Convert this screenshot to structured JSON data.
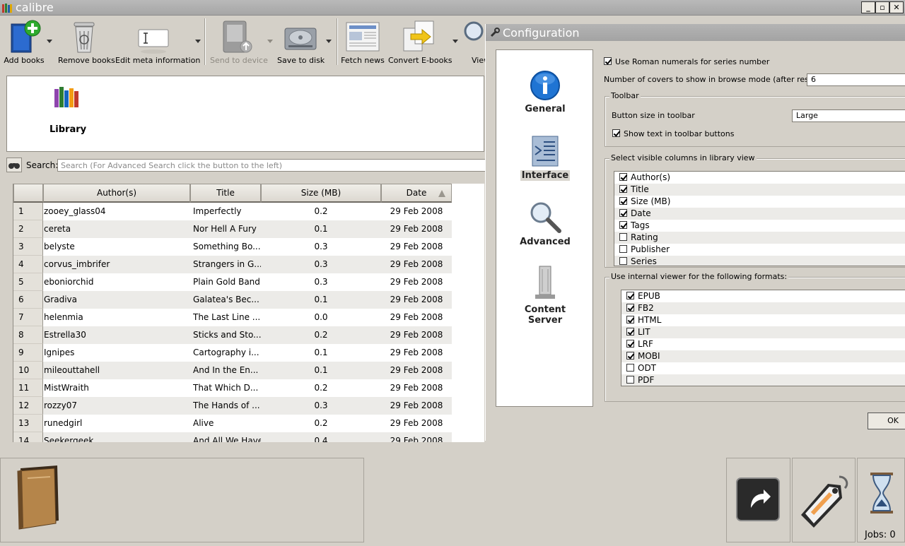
{
  "window": {
    "title": "calibre"
  },
  "toolbar": {
    "buttons": [
      {
        "label": "Add books",
        "icon": "add-book-icon",
        "disabled": false
      },
      {
        "label": "Remove books",
        "icon": "trash-icon",
        "disabled": false
      },
      {
        "label": "Edit meta information",
        "icon": "edit-metadata-icon",
        "disabled": false
      },
      {
        "label": "Send to device",
        "icon": "send-device-icon",
        "disabled": true
      },
      {
        "label": "Save to disk",
        "icon": "save-disk-icon",
        "disabled": false
      },
      {
        "label": "Fetch news",
        "icon": "news-icon",
        "disabled": false
      },
      {
        "label": "Convert E-books",
        "icon": "convert-icon",
        "disabled": false
      },
      {
        "label": "View",
        "icon": "view-icon",
        "disabled": false
      }
    ]
  },
  "location": {
    "library_label": "Library"
  },
  "search": {
    "label": "Search:",
    "placeholder": "Search (For Advanced Search click the button to the left)"
  },
  "table": {
    "headers": {
      "author": "Author(s)",
      "title": "Title",
      "size": "Size (MB)",
      "date": "Date"
    },
    "rows": [
      {
        "num": "1",
        "author": "zooey_glass04",
        "title": "Imperfectly",
        "size": "0.2",
        "date": "29 Feb 2008"
      },
      {
        "num": "2",
        "author": "cereta",
        "title": "Nor Hell A Fury",
        "size": "0.1",
        "date": "29 Feb 2008"
      },
      {
        "num": "3",
        "author": "belyste",
        "title": "Something Bo...",
        "size": "0.3",
        "date": "29 Feb 2008"
      },
      {
        "num": "4",
        "author": "corvus_imbrifer",
        "title": "Strangers in G...",
        "size": "0.3",
        "date": "29 Feb 2008"
      },
      {
        "num": "5",
        "author": "eboniorchid",
        "title": "Plain Gold Band",
        "size": "0.3",
        "date": "29 Feb 2008"
      },
      {
        "num": "6",
        "author": "Gradiva",
        "title": "Galatea's Bec...",
        "size": "0.1",
        "date": "29 Feb 2008"
      },
      {
        "num": "7",
        "author": "helenmia",
        "title": "The Last Line ...",
        "size": "0.0",
        "date": "29 Feb 2008"
      },
      {
        "num": "8",
        "author": "Estrella30",
        "title": "Sticks and Sto...",
        "size": "0.2",
        "date": "29 Feb 2008"
      },
      {
        "num": "9",
        "author": "Ignipes",
        "title": "Cartography i...",
        "size": "0.1",
        "date": "29 Feb 2008"
      },
      {
        "num": "10",
        "author": "mileouttahell",
        "title": "And In the En...",
        "size": "0.1",
        "date": "29 Feb 2008"
      },
      {
        "num": "11",
        "author": "MistWraith",
        "title": "That Which D...",
        "size": "0.2",
        "date": "29 Feb 2008"
      },
      {
        "num": "12",
        "author": "rozzy07",
        "title": "The Hands of ...",
        "size": "0.3",
        "date": "29 Feb 2008"
      },
      {
        "num": "13",
        "author": "runedgirl",
        "title": "Alive",
        "size": "0.2",
        "date": "29 Feb 2008"
      },
      {
        "num": "14",
        "author": "Seekergeek",
        "title": "And All We Have",
        "size": "0.4",
        "date": "29 Feb 2008"
      }
    ]
  },
  "status": {
    "jobs_label": "Jobs: 0"
  },
  "config": {
    "title": "Configuration",
    "categories": [
      {
        "label": "General",
        "icon": "info-icon"
      },
      {
        "label": "Interface",
        "icon": "interface-icon"
      },
      {
        "label": "Advanced",
        "icon": "magnifier-icon"
      },
      {
        "label": "Content Server",
        "icon": "server-icon"
      }
    ],
    "roman_numerals_label": "Use Roman numerals for series number",
    "roman_numerals_checked": true,
    "covers_label": "Number of covers to show in browse mode (after restart):",
    "covers_value": "6",
    "toolbar_group": "Toolbar",
    "button_size_label": "Button size in toolbar",
    "button_size_value": "Large",
    "show_text_label": "Show text in toolbar buttons",
    "show_text_checked": true,
    "columns_group": "Select visible columns in library view",
    "columns": [
      {
        "label": "Author(s)",
        "checked": true
      },
      {
        "label": "Title",
        "checked": true
      },
      {
        "label": "Size (MB)",
        "checked": true
      },
      {
        "label": "Date",
        "checked": true
      },
      {
        "label": "Tags",
        "checked": true
      },
      {
        "label": "Rating",
        "checked": false
      },
      {
        "label": "Publisher",
        "checked": false
      },
      {
        "label": "Series",
        "checked": false
      }
    ],
    "viewer_group": "Use internal viewer for the following formats:",
    "formats": [
      {
        "label": "EPUB",
        "checked": true
      },
      {
        "label": "FB2",
        "checked": true
      },
      {
        "label": "HTML",
        "checked": true
      },
      {
        "label": "LIT",
        "checked": true
      },
      {
        "label": "LRF",
        "checked": true
      },
      {
        "label": "MOBI",
        "checked": true
      },
      {
        "label": "ODT",
        "checked": false
      },
      {
        "label": "PDF",
        "checked": false
      }
    ],
    "ok_label": "OK"
  }
}
